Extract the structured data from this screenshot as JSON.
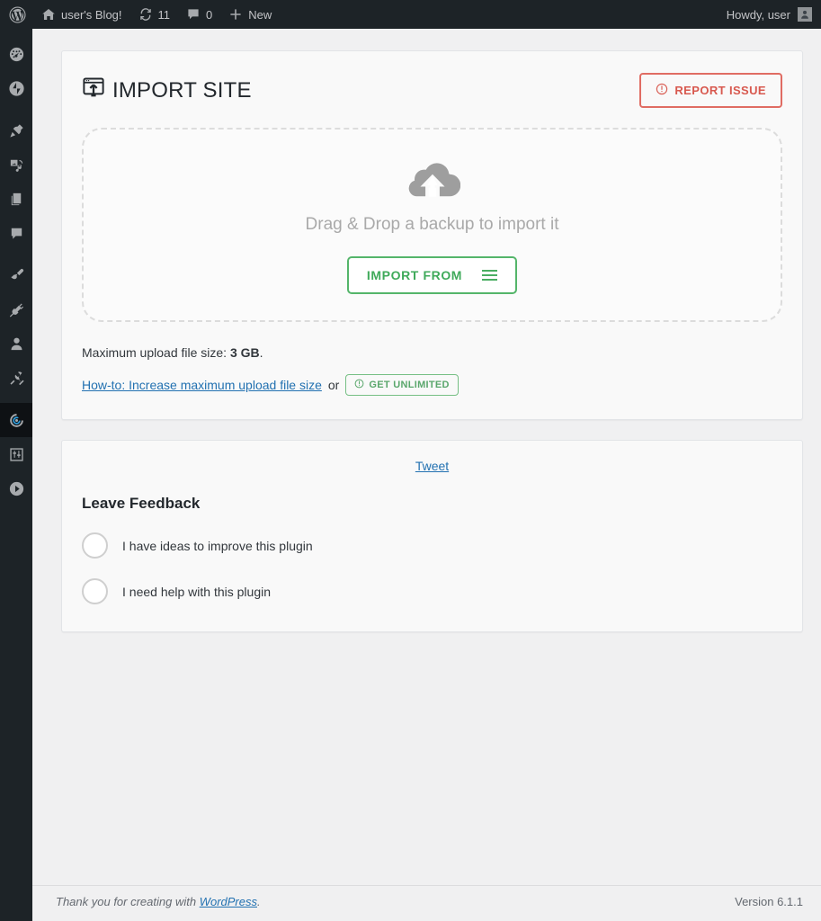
{
  "adminbar": {
    "wp_logo": "wordpress-logo",
    "site_name": "user's Blog!",
    "updates_count": "11",
    "comments_count": "0",
    "new_label": "New",
    "howdy": "Howdy, user"
  },
  "sidebar": {
    "items": [
      {
        "name": "dashboard",
        "icon": "dashboard-gauge-icon",
        "current": false
      },
      {
        "name": "jetpack",
        "icon": "jetpack-icon",
        "current": false
      },
      {
        "name": "posts",
        "icon": "pin-icon",
        "current": false
      },
      {
        "name": "media",
        "icon": "media-icon",
        "current": false
      },
      {
        "name": "pages",
        "icon": "pages-icon",
        "current": false
      },
      {
        "name": "comments",
        "icon": "comment-bubble-icon",
        "current": false
      },
      {
        "name": "appearance",
        "icon": "paint-brush-icon",
        "current": false
      },
      {
        "name": "plugins",
        "icon": "plug-icon",
        "current": false
      },
      {
        "name": "users",
        "icon": "user-icon",
        "current": false
      },
      {
        "name": "tools",
        "icon": "wrench-icon",
        "current": false
      },
      {
        "name": "all-in-one-wp-migration",
        "icon": "circular-arrow-icon",
        "current": true
      },
      {
        "name": "settings",
        "icon": "sliders-icon",
        "current": false
      },
      {
        "name": "collapse-menu",
        "icon": "play-circle-icon",
        "current": false
      }
    ]
  },
  "import": {
    "title": "IMPORT SITE",
    "title_icon": "window-upload-icon",
    "report_issue": {
      "label": "REPORT ISSUE",
      "icon": "exclamation-circle-icon",
      "color": "#d8594f"
    },
    "dropzone": {
      "icon": "cloud-upload-icon",
      "text": "Drag & Drop a backup to import it"
    },
    "import_from": {
      "label": "IMPORT FROM",
      "icon": "hamburger-menu-icon",
      "color": "#3faa5a"
    },
    "max_upload_prefix": "Maximum upload file size: ",
    "max_upload_value": "3 GB",
    "max_upload_suffix": ".",
    "howto_link": "How-to: Increase maximum upload file size",
    "or_text": "or",
    "get_unlimited": {
      "label": "GET UNLIMITED",
      "icon": "exclamation-circle-icon",
      "color": "#5aa76c"
    }
  },
  "feedback": {
    "tweet_label": "Tweet",
    "title": "Leave Feedback",
    "options": [
      {
        "label": "I have ideas to improve this plugin",
        "selected": false
      },
      {
        "label": "I need help with this plugin",
        "selected": false
      }
    ]
  },
  "footer": {
    "thanks_prefix": "Thank you for creating with ",
    "wordpress_link": "WordPress",
    "thanks_suffix": ".",
    "version": "Version 6.1.1"
  }
}
